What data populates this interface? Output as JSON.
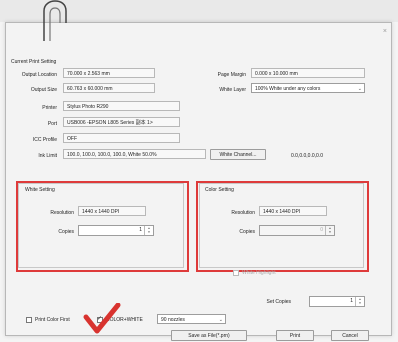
{
  "dialog": {
    "close_glyph": "×",
    "current_print_setting": "Current Print Setting"
  },
  "settings": {
    "output_location_label": "Output Location",
    "output_location_value": "70.000 x 2.563 mm",
    "output_size_label": "Output Size",
    "output_size_value": "60.763 x 60.000 mm",
    "printer_label": "Printer",
    "printer_value": "Stylus Photo R290",
    "port_label": "Port",
    "port_value": "USB006 -EPSON L805 Series 副本 1>",
    "icc_profile_label": "ICC Profile",
    "icc_profile_value": "OFF",
    "ink_limit_label": "Ink Limit",
    "ink_limit_value": "100.0, 100.0, 100.0, 100.0, White 50.0%",
    "white_channel_button": "White Channel...",
    "white_channel_value": "0.0,0.0,0.0,0.0",
    "page_margin_label": "Page Margin",
    "page_margin_value": "0.000 x 10.000 mm",
    "white_layer_label": "White Layer",
    "white_layer_value": "100% White under any colors"
  },
  "white_setting": {
    "title": "White Setting",
    "resolution_label": "Resolution",
    "resolution_value": "1440 x 1440 DPI",
    "copies_label": "Copies",
    "copies_value": "1"
  },
  "color_setting": {
    "title": "Color Setting",
    "resolution_label": "Resolution",
    "resolution_value": "1440 x 1440 DPI",
    "copies_label": "Copies",
    "copies_value": "0",
    "white_highlight_label": "White Highlight"
  },
  "footer": {
    "set_copies_label": "Set Copies",
    "set_copies_value": "1",
    "print_color_first_label": "Print Color First",
    "color_white_label": "COLOR+WHITE",
    "nozzles_value": "90 nozzles",
    "save_as_file_button": "Save as File(*.prn)",
    "print_button": "Print",
    "cancel_button": "Cancel"
  },
  "colors": {
    "highlight_red": "#de3a3a",
    "checkmark_red": "#d8332f"
  }
}
